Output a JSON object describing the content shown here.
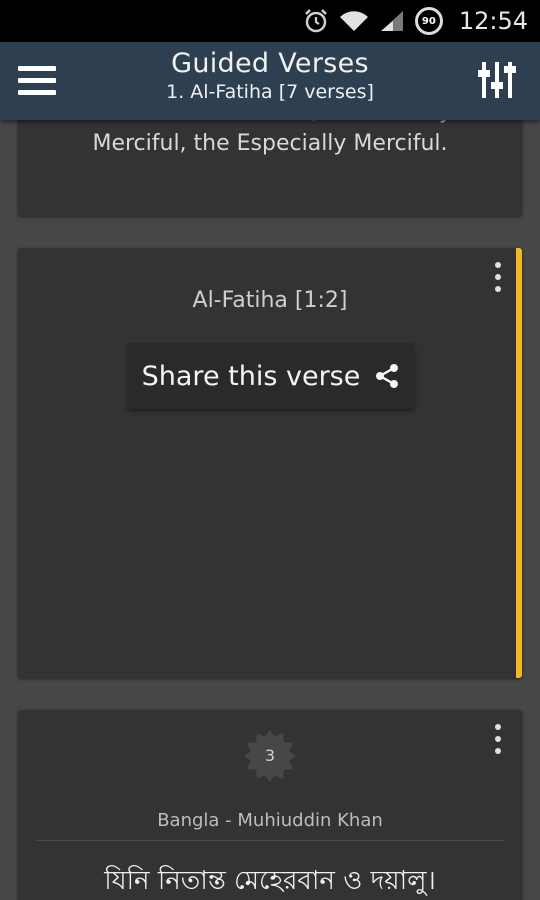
{
  "status_bar": {
    "time": "12:54",
    "battery_level": "90"
  },
  "toolbar": {
    "title": "Guided Verses",
    "subtitle": "1. Al-Fatiha [7 verses]"
  },
  "cards": [
    {
      "translation": "In the name of Allah, the Entirely Merciful, the Especially Merciful.",
      "translation_line1": "In the name of Allah, the Entirely",
      "translation_line2": "Merciful, the Especially Merciful."
    },
    {
      "verse_ref": "Al-Fatiha [1:2]",
      "share_label": "Share this verse",
      "accent_color": "#f2b824"
    },
    {
      "verse_number": "3",
      "translator": "Bangla - Muhiuddin Khan",
      "bangla_text": "যিনি নিতান্ত মেহেরবান ও দয়ালু।"
    }
  ],
  "colors": {
    "toolbar": "#2f3f52",
    "background": "#474747",
    "card": "#333333",
    "accent": "#f2b824"
  }
}
